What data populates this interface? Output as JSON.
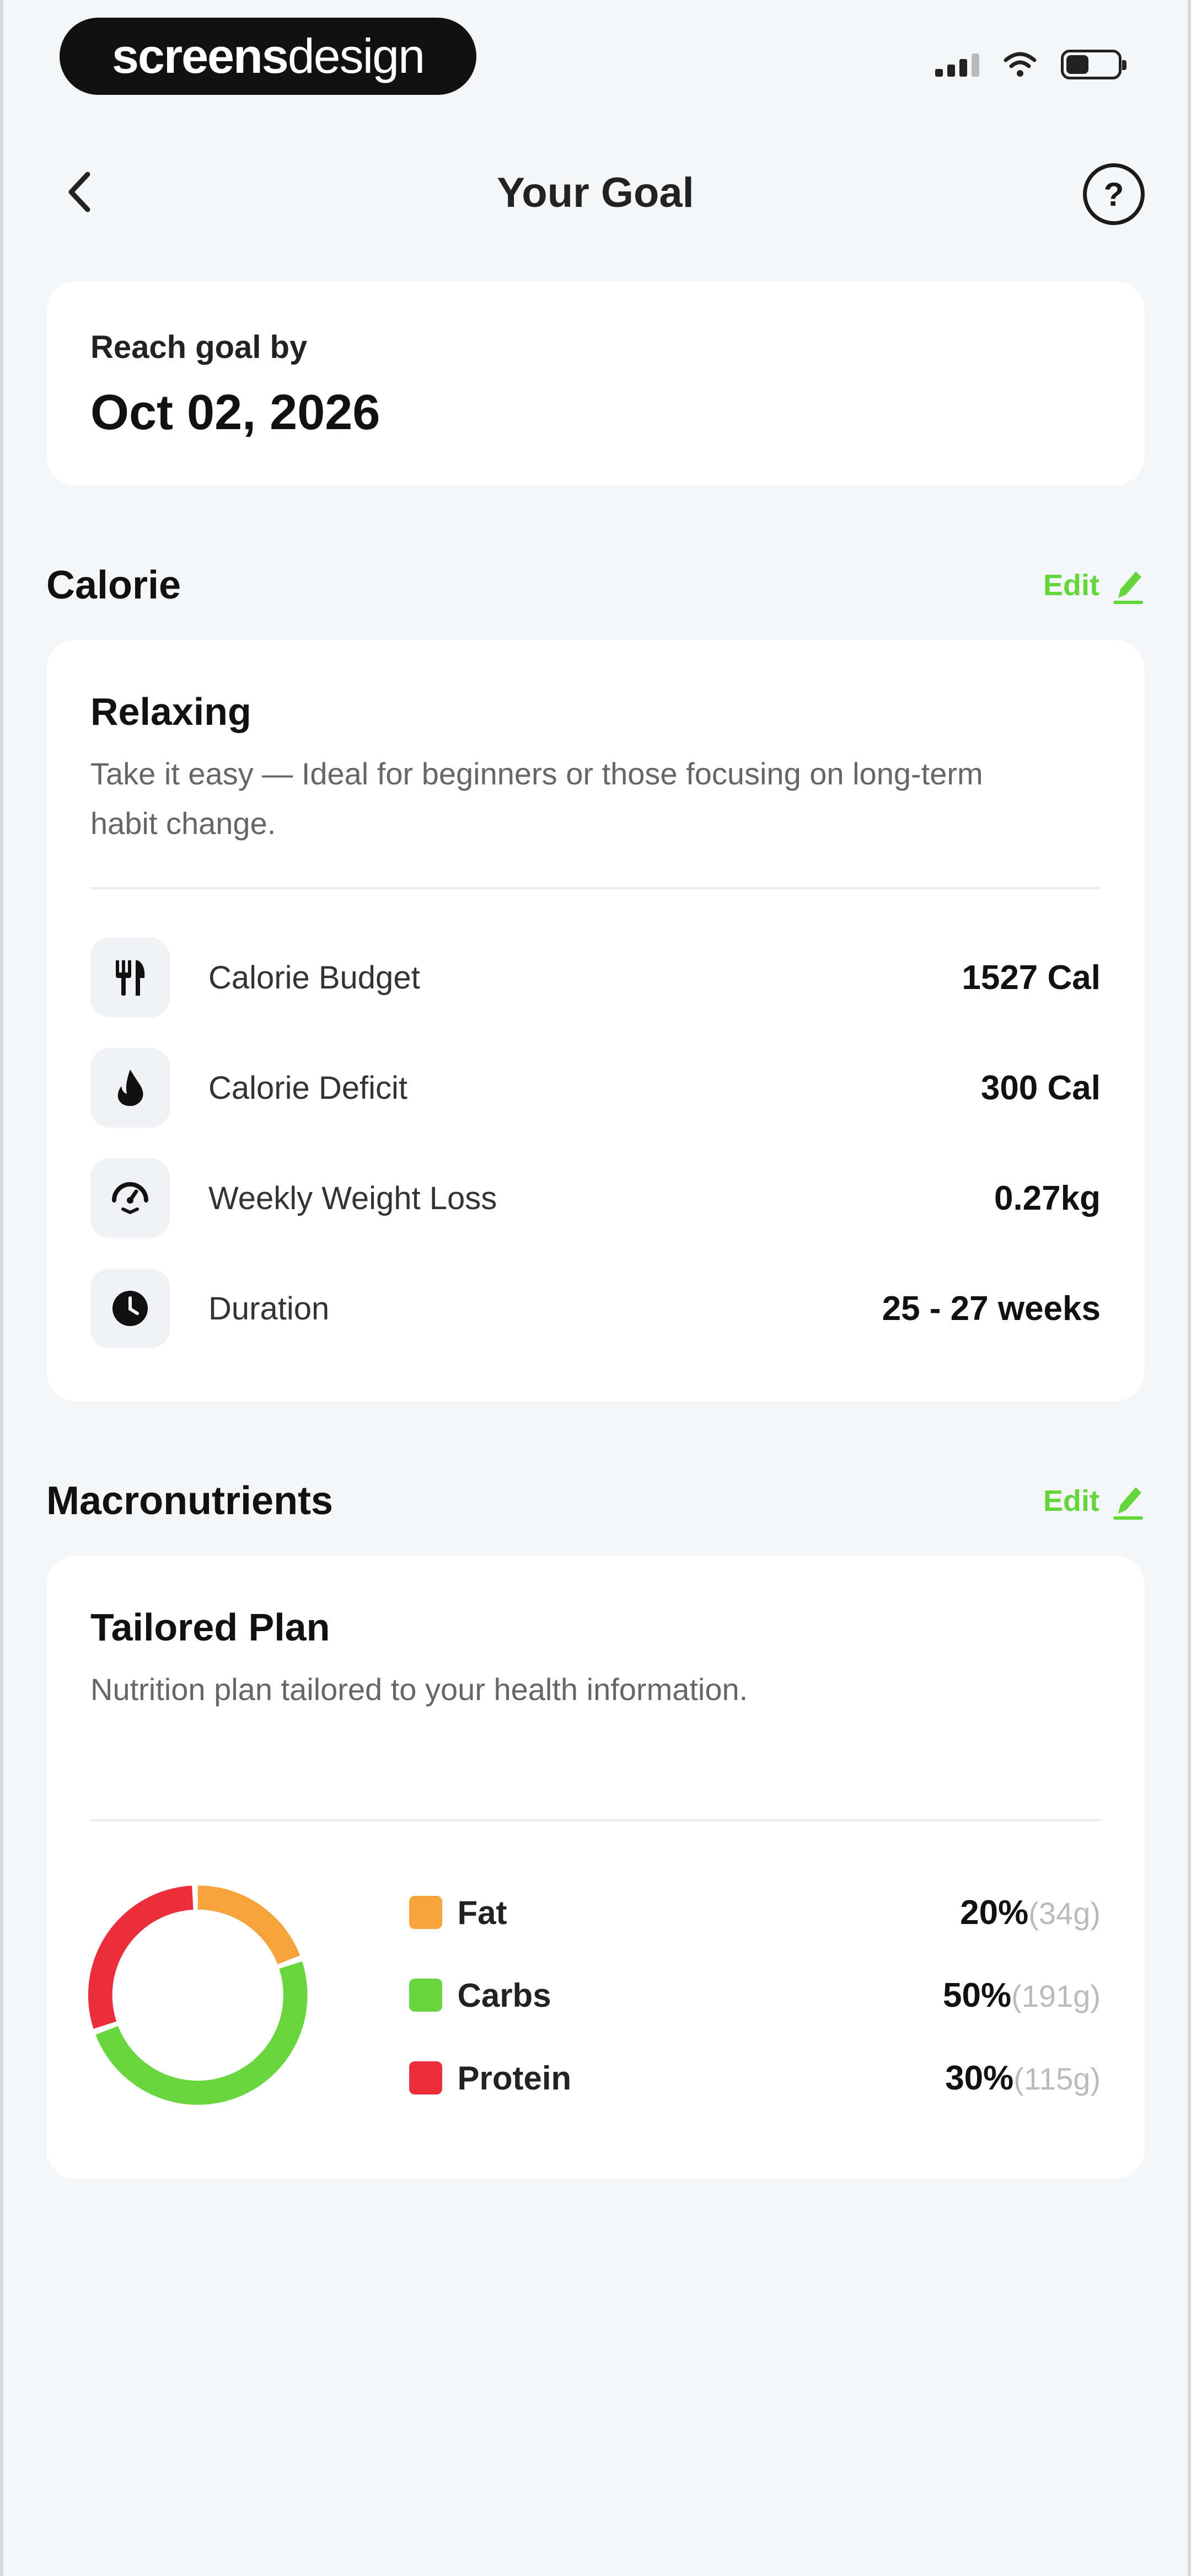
{
  "status_bar": {
    "brand_bold": "screens",
    "brand_light": "design"
  },
  "header": {
    "title": "Your Goal",
    "help_label": "?"
  },
  "goal": {
    "label": "Reach goal by",
    "date": "Oct 02, 2026"
  },
  "calorie": {
    "section_title": "Calorie",
    "edit_label": "Edit",
    "plan_name": "Relaxing",
    "plan_description": "Take it easy — Ideal for beginners or those focusing on long-term habit change.",
    "stats": [
      {
        "icon": "utensils-icon",
        "label": "Calorie Budget",
        "value": "1527 Cal"
      },
      {
        "icon": "flame-icon",
        "label": "Calorie Deficit",
        "value": "300 Cal"
      },
      {
        "icon": "scale-icon",
        "label": "Weekly Weight Loss",
        "value": "0.27kg"
      },
      {
        "icon": "clock-icon",
        "label": "Duration",
        "value": "25 - 27 weeks"
      }
    ]
  },
  "macros": {
    "section_title": "Macronutrients",
    "edit_label": "Edit",
    "plan_name": "Tailored Plan",
    "plan_description": "Nutrition plan tailored to your health information.",
    "items": [
      {
        "name": "Fat",
        "percent": "20%",
        "grams": "(34g)",
        "fraction": 0.2,
        "color": "#f5a33b"
      },
      {
        "name": "Carbs",
        "percent": "50%",
        "grams": "(191g)",
        "fraction": 0.5,
        "color": "#6ad63f"
      },
      {
        "name": "Protein",
        "percent": "30%",
        "grams": "(115g)",
        "fraction": 0.3,
        "color": "#ec2d3b"
      }
    ]
  }
}
